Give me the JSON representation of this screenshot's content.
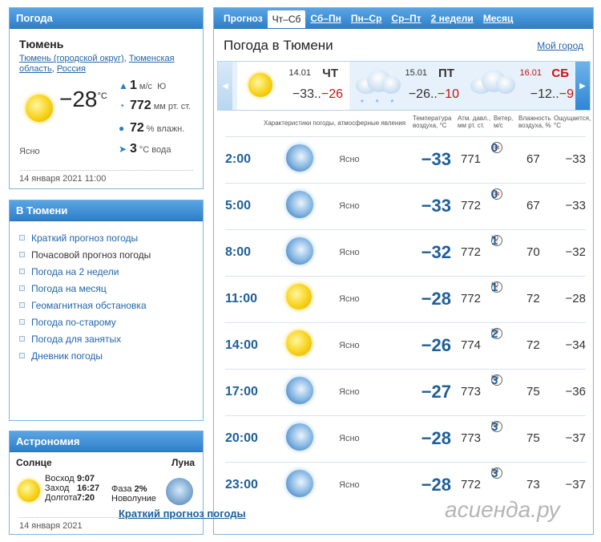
{
  "weather": {
    "header": "Погода",
    "city": "Тюмень",
    "crumbs": [
      "Тюмень (городской округ)",
      "Тюменская область",
      "Россия"
    ],
    "temp": "−28",
    "temp_unit": "°C",
    "condition": "Ясно",
    "wind_value": "1",
    "wind_unit": "м/с",
    "wind_dir": "Ю",
    "pressure_value": "772",
    "pressure_unit": "мм рт. ст.",
    "humidity_value": "72",
    "humidity_unit": "% влажн.",
    "water_value": "3",
    "water_unit": "°C вода",
    "updated": "14 января 2021 11:00"
  },
  "links": {
    "header": "В Тюмени",
    "items": [
      {
        "label": "Краткий прогноз погоды",
        "current": false
      },
      {
        "label": "Почасовой прогноз погоды",
        "current": true
      },
      {
        "label": "Погода на 2 недели",
        "current": false
      },
      {
        "label": "Погода на месяц",
        "current": false
      },
      {
        "label": "Геомагнитная обстановка",
        "current": false
      },
      {
        "label": "Погода по-старому",
        "current": false
      },
      {
        "label": "Погода для занятых",
        "current": false
      },
      {
        "label": "Дневник погоды",
        "current": false
      }
    ]
  },
  "astro": {
    "header": "Астрономия",
    "sun": "Солнце",
    "moon": "Луна",
    "sunrise_label": "Восход",
    "sunrise": "9:07",
    "sunset_label": "Заход",
    "sunset": "16:27",
    "daylength_label": "Долгота",
    "daylength": "7:20",
    "phase_label": "Фаза",
    "phase": "2%",
    "phase_name": "Новолуние",
    "date": "14 января 2021"
  },
  "forecast": {
    "tabs": [
      {
        "label": "Прогноз",
        "kind": "title"
      },
      {
        "label": "Чт–Сб",
        "kind": "active"
      },
      {
        "label": "Сб–Пн",
        "kind": "link"
      },
      {
        "label": "Пн–Ср",
        "kind": "link"
      },
      {
        "label": "Ср–Пт",
        "kind": "link"
      },
      {
        "label": "2 недели",
        "kind": "link"
      },
      {
        "label": "Месяц",
        "kind": "link"
      }
    ],
    "title": "Погода в Тюмени",
    "my_city": "Мой город",
    "days": [
      {
        "date": "14.01",
        "name": "ЧТ",
        "min": "−33..",
        "max": "−26",
        "icon": "sun-icon",
        "weekend": false
      },
      {
        "date": "15.01",
        "name": "ПТ",
        "min": "−26..",
        "max": "−10",
        "icon": "snow-cloud-icon",
        "weekend": false
      },
      {
        "date": "16.01",
        "name": "СБ",
        "min": "−12..",
        "max": "−9",
        "icon": "cloud-icon",
        "weekend": true
      }
    ],
    "columns": {
      "characteristics": "Характеристики погоды, атмосферные явления",
      "temp": "Температура воздуха, °C",
      "pressure": "Атм. давл., мм рт. ст.",
      "wind": "Ветер, м/с",
      "humidity": "Влажность воздуха, %",
      "feels": "Ощущается, °C"
    },
    "rows": [
      {
        "time": "2:00",
        "icon": "moon-icon",
        "cond": "Ясно",
        "temp": "−33",
        "pressure": "771",
        "wind_dir": "",
        "wind": "0",
        "humidity": "67",
        "feels": "−33"
      },
      {
        "time": "5:00",
        "icon": "moon-icon",
        "cond": "Ясно",
        "temp": "−33",
        "pressure": "772",
        "wind_dir": "",
        "wind": "0",
        "humidity": "67",
        "feels": "−33"
      },
      {
        "time": "8:00",
        "icon": "moon-icon",
        "cond": "Ясно",
        "temp": "−32",
        "pressure": "772",
        "wind_dir": "Ю",
        "wind": "1",
        "humidity": "70",
        "feels": "−32"
      },
      {
        "time": "11:00",
        "icon": "sun-icon",
        "cond": "Ясно",
        "temp": "−28",
        "pressure": "772",
        "wind_dir": "Ю",
        "wind": "1",
        "humidity": "72",
        "feels": "−28"
      },
      {
        "time": "14:00",
        "icon": "sun-icon",
        "cond": "Ясно",
        "temp": "−26",
        "pressure": "774",
        "wind_dir": "Ю",
        "wind": "2",
        "humidity": "72",
        "feels": "−34"
      },
      {
        "time": "17:00",
        "icon": "moon-icon",
        "cond": "Ясно",
        "temp": "−27",
        "pressure": "773",
        "wind_dir": "Ю",
        "wind": "3",
        "humidity": "75",
        "feels": "−36"
      },
      {
        "time": "20:00",
        "icon": "moon-icon",
        "cond": "Ясно",
        "temp": "−28",
        "pressure": "773",
        "wind_dir": "Ю",
        "wind": "3",
        "humidity": "75",
        "feels": "−37"
      },
      {
        "time": "23:00",
        "icon": "moon-icon",
        "cond": "Ясно",
        "temp": "−28",
        "pressure": "772",
        "wind_dir": "Ю",
        "wind": "3",
        "humidity": "73",
        "feels": "−37"
      }
    ],
    "more_link": "Краткий прогноз погоды"
  },
  "watermark": "асиенда.ру"
}
